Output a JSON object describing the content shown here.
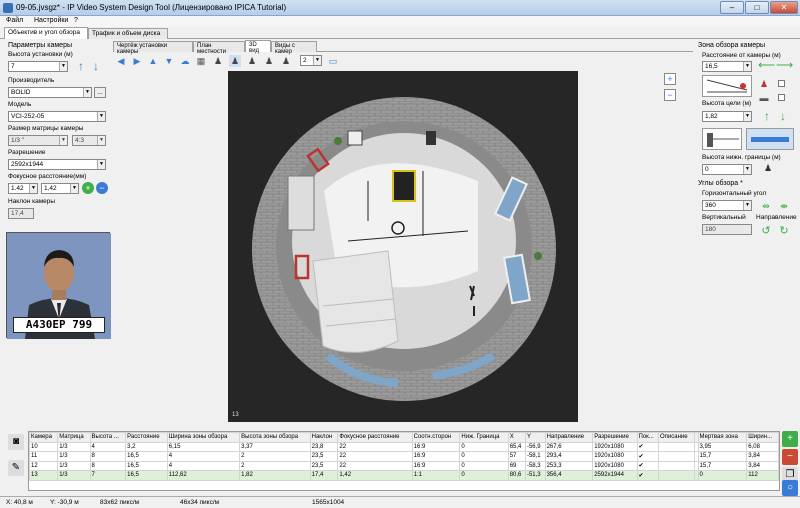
{
  "window": {
    "title": "09-05.jvsgz* - IP Video System Design Tool (Лицензировано  IPICA Tutorial)"
  },
  "menu": [
    "Файл",
    "Настройки",
    "?"
  ],
  "main_tabs": [
    "Объектив и угол обзора",
    "Трафик и объем диска"
  ],
  "left": {
    "section": "Параметры камеры",
    "height_label": "Высота установки (м)",
    "height_value": "7",
    "maker_label": "Производитель",
    "maker_value": "BOLID",
    "maker_btn": "...",
    "model_label": "Модель",
    "model_value": "VCI-252-05",
    "matrix_label": "Размер матрицы камеры",
    "matrix_value": "1/3 \"",
    "aspect_value": "4:3",
    "res_label": "Разрешение",
    "res_value": "2592x1944",
    "focal_label": "Фокусное расстояние(мм)",
    "focal_min": "1.42",
    "focal_max": "1,42",
    "tilt_label": "Наклон камеры",
    "tilt_value": "17,4",
    "plate_text": "А430ЕР 799"
  },
  "view_tabs": [
    "Чертёж установки камеры",
    "План местности",
    "3D вид",
    "Виды с камер"
  ],
  "toolbar": {
    "cam_number": "2"
  },
  "view": {
    "frame_label": "13"
  },
  "right": {
    "zone_title": "Зона обзора камеры",
    "dist_label": "Расстояние от камеры (м)",
    "dist_value": "16,5",
    "target_label": "Высота цели (м)",
    "target_value": "1,82",
    "lower_label": "Высота нижн. границы (м)",
    "lower_value": "0",
    "angles_title": "Углы обзора *",
    "hangle_label": "Горизонтальный угол",
    "hangle_value": "360",
    "vangle_label": "Вертикальный",
    "vangle_value": "180",
    "dir_label": "Направление"
  },
  "table": {
    "columns": [
      "Камера",
      "Матрица",
      "Высота ...",
      "Расстояние",
      "Ширина зоны обзора",
      "Высота зоны обзора",
      "Наклон",
      "Фокусное расстояние",
      "Соотн.сторон",
      "Ниж. Граница",
      "X",
      "Y",
      "Направление",
      "Разрешение",
      "Пок...",
      "Описание",
      "",
      "Мертвая зона",
      "Ширин..."
    ],
    "rows": [
      [
        "10",
        "1/3",
        "4",
        "3,2",
        "6,15",
        "3,37",
        "23,8",
        "22",
        "16:9",
        "0",
        "65,4",
        "-56,9",
        "267,6",
        "1920x1080",
        "✔",
        "",
        "",
        "3,95",
        "6,08"
      ],
      [
        "11",
        "1/3",
        "8",
        "16,5",
        "4",
        "2",
        "23,5",
        "22",
        "16:9",
        "0",
        "57",
        "-58,1",
        "293,4",
        "1920x1080",
        "✔",
        "",
        "",
        "15,7",
        "3,84"
      ],
      [
        "12",
        "1/3",
        "8",
        "16,5",
        "4",
        "2",
        "23,5",
        "22",
        "16:9",
        "0",
        "69",
        "-58,3",
        "253,3",
        "1920x1080",
        "✔",
        "",
        "",
        "15,7",
        "3,84"
      ],
      [
        "13",
        "1/3",
        "7",
        "16,5",
        "112,62",
        "1,82",
        "17,4",
        "1,42",
        "1:1",
        "0",
        "80,6",
        "-51,3",
        "356,4",
        "2592x1944",
        "✔",
        "",
        "",
        "0",
        "112"
      ]
    ]
  },
  "status": {
    "x": "X: 40,8 м",
    "y": "Y: -30,9 м",
    "res1": "83x62 пикс/м",
    "res2": "46x34 пикс/м",
    "size": "1565x1004"
  }
}
